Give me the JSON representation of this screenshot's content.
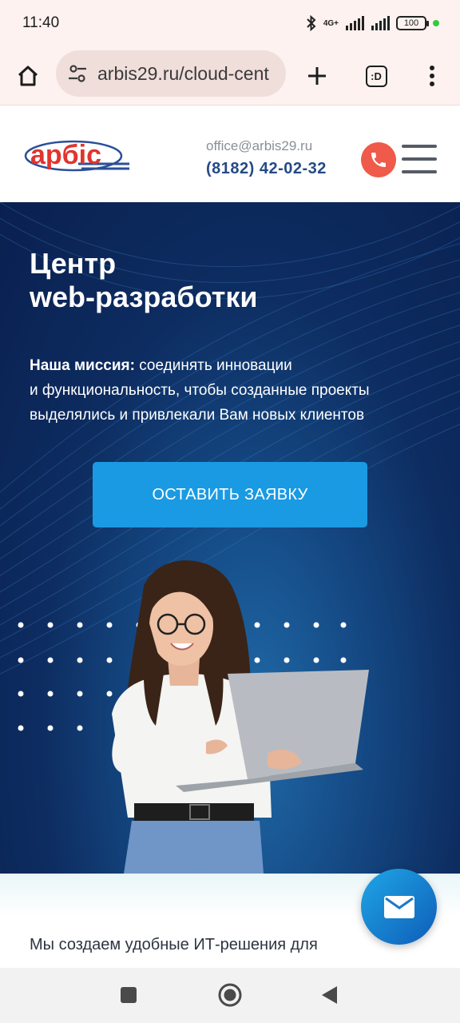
{
  "status_bar": {
    "time": "11:40",
    "network": "4G+",
    "battery": "100"
  },
  "browser": {
    "url": "arbis29.ru/cloud-cent",
    "tabs_badge": ":D"
  },
  "header": {
    "logo_text": "арбіс",
    "email": "office@arbis29.ru",
    "phone": "(8182) 42-02-32"
  },
  "hero": {
    "title_line1": "Центр",
    "title_line2": "web-разработки",
    "mission_label": "Наша миссия:",
    "mission_line1": " соединять инновации",
    "mission_line2": "и функциональность, чтобы созданные проекты",
    "mission_line3": "выделялись и привлекали Вам новых клиентов",
    "cta_label": "ОСТАВИТЬ ЗАЯВКУ"
  },
  "below": {
    "text": "Мы создаем удобные ИТ-решения для"
  },
  "colors": {
    "accent": "#1a9ae2",
    "phone_text": "#254a86",
    "call_button": "#ef5a4a",
    "hero_dark": "#0a2050"
  },
  "icons": {
    "home": "home-icon",
    "site_settings": "tune-icon",
    "new_tab": "plus-icon",
    "menu": "more-vert-icon",
    "call": "phone-icon",
    "burger": "menu-icon",
    "mail": "mail-icon"
  }
}
